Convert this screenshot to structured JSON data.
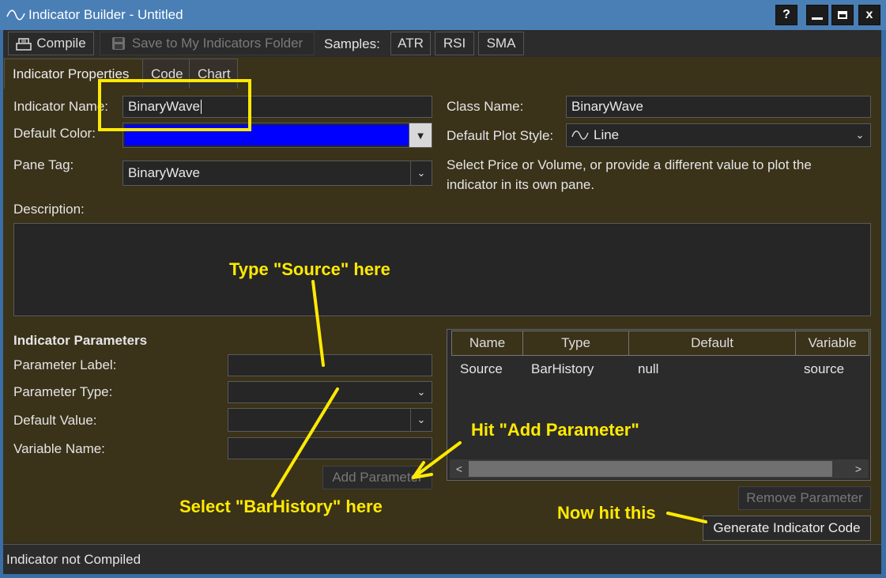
{
  "window": {
    "title": "Indicator Builder - Untitled",
    "help_label": "?",
    "minimize_label": "—",
    "maximize_label": "▢",
    "close_label": "x"
  },
  "toolbar": {
    "compile_label": "Compile",
    "save_label": "Save to My Indicators Folder",
    "samples_label": "Samples:",
    "samples": [
      "ATR",
      "RSI",
      "SMA"
    ]
  },
  "tabs": [
    "Indicator Properties",
    "Code",
    "Chart"
  ],
  "form": {
    "indicator_name_label": "Indicator Name:",
    "indicator_name_value": "BinaryWave",
    "default_color_label": "Default Color:",
    "default_color_value": "#0000ff",
    "pane_tag_label": "Pane Tag:",
    "pane_tag_value": "BinaryWave",
    "class_name_label": "Class Name:",
    "class_name_value": "BinaryWave",
    "plot_style_label": "Default Plot Style:",
    "plot_style_value": "Line",
    "pane_help_line1": "Select Price or Volume, or provide a different value to plot the",
    "pane_help_line2": "indicator in its own pane.",
    "description_label": "Description:",
    "description_value": ""
  },
  "parameters": {
    "heading": "Indicator Parameters",
    "label_label": "Parameter Label:",
    "type_label": "Parameter Type:",
    "default_label": "Default Value:",
    "variable_label": "Variable Name:",
    "label_value": "",
    "type_value": "",
    "default_value": "",
    "variable_value": "",
    "add_button": "Add Parameter",
    "remove_button": "Remove Parameter",
    "columns": [
      "Name",
      "Type",
      "Default",
      "Variable"
    ],
    "rows": [
      {
        "name": "Source",
        "type": "BarHistory",
        "default": "null",
        "variable": "source"
      }
    ]
  },
  "generate_button": "Generate Indicator Code",
  "status": "Indicator not Compiled",
  "annotations": {
    "type_source": "Type \"Source\" here",
    "hit_add": "Hit \"Add Parameter\"",
    "select_barhistory": "Select \"BarHistory\" here",
    "now_hit": "Now hit this",
    "color": "#ffea00"
  }
}
